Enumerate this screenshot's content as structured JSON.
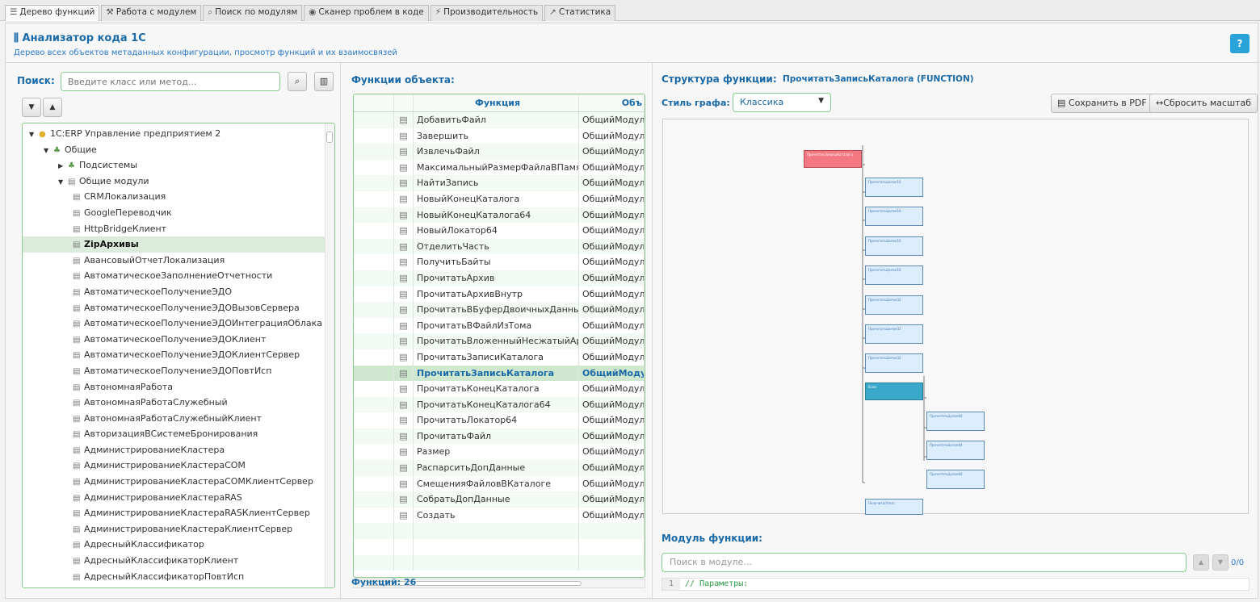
{
  "tabs": [
    {
      "icon": "tree-icon",
      "glyph": "☰",
      "label": "Дерево функций"
    },
    {
      "icon": "wrench-icon",
      "glyph": "⚒",
      "label": "Работа с модулем"
    },
    {
      "icon": "search-icon",
      "glyph": "⌕",
      "label": "Поиск по модулям"
    },
    {
      "icon": "shield-icon",
      "glyph": "◉",
      "label": "Сканер проблем в коде"
    },
    {
      "icon": "bolt-icon",
      "glyph": "⚡",
      "label": "Производительность"
    },
    {
      "icon": "chart-icon",
      "glyph": "↗",
      "label": "Статистика"
    }
  ],
  "header": {
    "title": "Анализатор кода 1С",
    "subtitle": "Дерево всех объектов метаданных конфигурации, просмотр функций и их взаимосвязей",
    "help_label": "?"
  },
  "left": {
    "search_label": "Поиск:",
    "search_placeholder": "Введите класс или метод...",
    "tree": [
      {
        "label": "1С:ERP Управление предприятием 2",
        "tri": "▼",
        "icon": "database-icon",
        "glyph": "●",
        "level": 0
      },
      {
        "label": "Общие",
        "tri": "▼",
        "icon": "folder-icon",
        "glyph": "♣",
        "level": 1
      },
      {
        "label": "Подсистемы",
        "tri": "▶",
        "icon": "hierarchy-icon",
        "glyph": "♣",
        "level": 2
      },
      {
        "label": "Общие модули",
        "tri": "▼",
        "icon": "module-icon",
        "glyph": "▤",
        "level": 2
      },
      {
        "label": "CRMЛокализация",
        "level": 3
      },
      {
        "label": "GoogleПереводчик",
        "level": 3
      },
      {
        "label": "HttpBridgeКлиент",
        "level": 3
      },
      {
        "label": "ZipАрхивы",
        "level": 3,
        "selected": true
      },
      {
        "label": "АвансовыйОтчетЛокализация",
        "level": 3
      },
      {
        "label": "АвтоматическоеЗаполнениеОтчетности",
        "level": 3
      },
      {
        "label": "АвтоматическоеПолучениеЭДО",
        "level": 3
      },
      {
        "label": "АвтоматическоеПолучениеЭДОВызовСервера",
        "level": 3
      },
      {
        "label": "АвтоматическоеПолучениеЭДОИнтеграцияОблака",
        "level": 3
      },
      {
        "label": "АвтоматическоеПолучениеЭДОКлиент",
        "level": 3
      },
      {
        "label": "АвтоматическоеПолучениеЭДОКлиентСервер",
        "level": 3
      },
      {
        "label": "АвтоматическоеПолучениеЭДОПовтИсп",
        "level": 3
      },
      {
        "label": "АвтономнаяРабота",
        "level": 3
      },
      {
        "label": "АвтономнаяРаботаСлужебный",
        "level": 3
      },
      {
        "label": "АвтономнаяРаботаСлужебныйКлиент",
        "level": 3
      },
      {
        "label": "АвторизацияВСистемеБронирования",
        "level": 3
      },
      {
        "label": "АдминистрированиеКластера",
        "level": 3
      },
      {
        "label": "АдминистрированиеКластераCOM",
        "level": 3
      },
      {
        "label": "АдминистрированиеКластераCOMКлиентСервер",
        "level": 3
      },
      {
        "label": "АдминистрированиеКластераRAS",
        "level": 3
      },
      {
        "label": "АдминистрированиеКластераRASКлиентСервер",
        "level": 3
      },
      {
        "label": "АдминистрированиеКластераКлиентСервер",
        "level": 3
      },
      {
        "label": "АдресныйКлассификатор",
        "level": 3
      },
      {
        "label": "АдресныйКлассификаторКлиент",
        "level": 3
      },
      {
        "label": "АдресныйКлассификаторПовтИсп",
        "level": 3
      }
    ]
  },
  "middle": {
    "title": "Функции объекта:",
    "col_function": "Функция",
    "col_object": "Объ",
    "rows": [
      {
        "fn": "ДобавитьФайл",
        "obj": "ОбщийМодуль"
      },
      {
        "fn": "Завершить",
        "obj": "ОбщийМодуль"
      },
      {
        "fn": "ИзвлечьФайл",
        "obj": "ОбщийМодуль"
      },
      {
        "fn": "МаксимальныйРазмерФайлаВПамяти",
        "obj": "ОбщийМодуль"
      },
      {
        "fn": "НайтиЗапись",
        "obj": "ОбщийМодуль"
      },
      {
        "fn": "НовыйКонецКаталога",
        "obj": "ОбщийМодуль"
      },
      {
        "fn": "НовыйКонецКаталога64",
        "obj": "ОбщийМодуль"
      },
      {
        "fn": "НовыйЛокатор64",
        "obj": "ОбщийМодуль"
      },
      {
        "fn": "ОтделитьЧасть",
        "obj": "ОбщийМодуль"
      },
      {
        "fn": "ПолучитьБайты",
        "obj": "ОбщийМодуль"
      },
      {
        "fn": "ПрочитатьАрхив",
        "obj": "ОбщийМодуль"
      },
      {
        "fn": "ПрочитатьАрхивВнутр",
        "obj": "ОбщийМодуль"
      },
      {
        "fn": "ПрочитатьВБуферДвоичныхДанных",
        "obj": "ОбщийМодуль"
      },
      {
        "fn": "ПрочитатьВФайлИзТома",
        "obj": "ОбщийМодуль"
      },
      {
        "fn": "ПрочитатьВложенныйНесжатыйАр...",
        "obj": "ОбщийМодуль"
      },
      {
        "fn": "ПрочитатьЗаписиКаталога",
        "obj": "ОбщийМодуль"
      },
      {
        "fn": "ПрочитатьЗаписьКаталога",
        "obj": "ОбщийМодул",
        "selected": true
      },
      {
        "fn": "ПрочитатьКонецКаталога",
        "obj": "ОбщийМодуль"
      },
      {
        "fn": "ПрочитатьКонецКаталога64",
        "obj": "ОбщийМодуль"
      },
      {
        "fn": "ПрочитатьЛокатор64",
        "obj": "ОбщийМодуль"
      },
      {
        "fn": "ПрочитатьФайл",
        "obj": "ОбщийМодуль"
      },
      {
        "fn": "Размер",
        "obj": "ОбщийМодуль"
      },
      {
        "fn": "РаспарситьДопДанные",
        "obj": "ОбщийМодуль"
      },
      {
        "fn": "СмещенияФайловВКаталоге",
        "obj": "ОбщийМодуль"
      },
      {
        "fn": "СобратьДопДанные",
        "obj": "ОбщийМодуль"
      },
      {
        "fn": "Создать",
        "obj": "ОбщийМодуль"
      }
    ],
    "count_label": "Функций: 26"
  },
  "right": {
    "title": "Структура функции:",
    "function_name": "ПрочитатьЗаписьКаталога (FUNCTION)",
    "style_label": "Стиль графа:",
    "style_value": "Классика",
    "save_pdf_label": "Сохранить в PDF",
    "reset_scale_label": "Сбросить масштаб",
    "graph_nodes": [
      {
        "id": "root",
        "kind": "root",
        "title": "ПрочитатьЗаписьКаталога"
      },
      {
        "id": "n1",
        "kind": "normal",
        "title": "ПрочитатьЦелое16"
      },
      {
        "id": "n2",
        "kind": "normal",
        "title": "ПрочитатьЦелое16"
      },
      {
        "id": "n3",
        "kind": "normal",
        "title": "ПрочитатьЦелое16"
      },
      {
        "id": "n4",
        "kind": "normal",
        "title": "ПрочитатьЦелое16"
      },
      {
        "id": "n5",
        "kind": "normal",
        "title": "ПрочитатьЦелое32"
      },
      {
        "id": "n6",
        "kind": "normal",
        "title": "ПрочитатьЦелое32"
      },
      {
        "id": "n7",
        "kind": "normal",
        "title": "ПрочитатьЦелое32"
      },
      {
        "id": "n8",
        "kind": "hl",
        "title": "Если"
      },
      {
        "id": "n9",
        "kind": "normal",
        "title": "ПрочитатьЦелое64"
      },
      {
        "id": "n10",
        "kind": "normal",
        "title": "ПрочитатьЦелое64"
      },
      {
        "id": "n11",
        "kind": "normal",
        "title": "ПрочитатьЦелое64"
      },
      {
        "id": "n12",
        "kind": "normal",
        "title": "Получить(Узел)"
      }
    ],
    "module_title": "Модуль функции:",
    "module_search_placeholder": "Поиск в модуле...",
    "match_counter": "0/0",
    "code_line_no": "1",
    "code_line": "// Параметры:"
  }
}
